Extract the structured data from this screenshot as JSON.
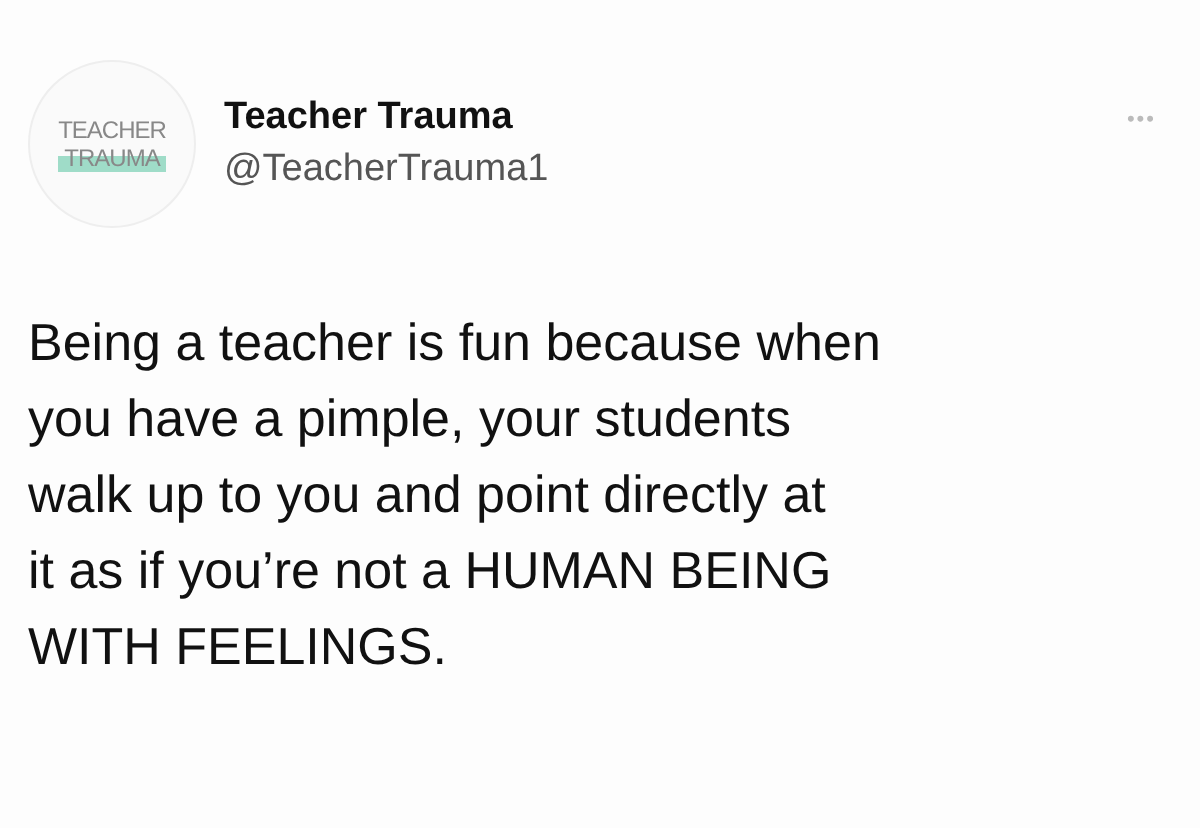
{
  "author": {
    "avatar_lines": [
      "TEACHER",
      "TRAUMA"
    ],
    "name": "Teacher Trauma",
    "handle": "@TeacherTrauma1"
  },
  "more_button": "•••",
  "tweet_lines": [
    "Being a teacher is fun because when",
    "you have a pimple, your students",
    "walk up to you and point directly at",
    "it as if you’re not a HUMAN BEING",
    "WITH FEELINGS."
  ]
}
